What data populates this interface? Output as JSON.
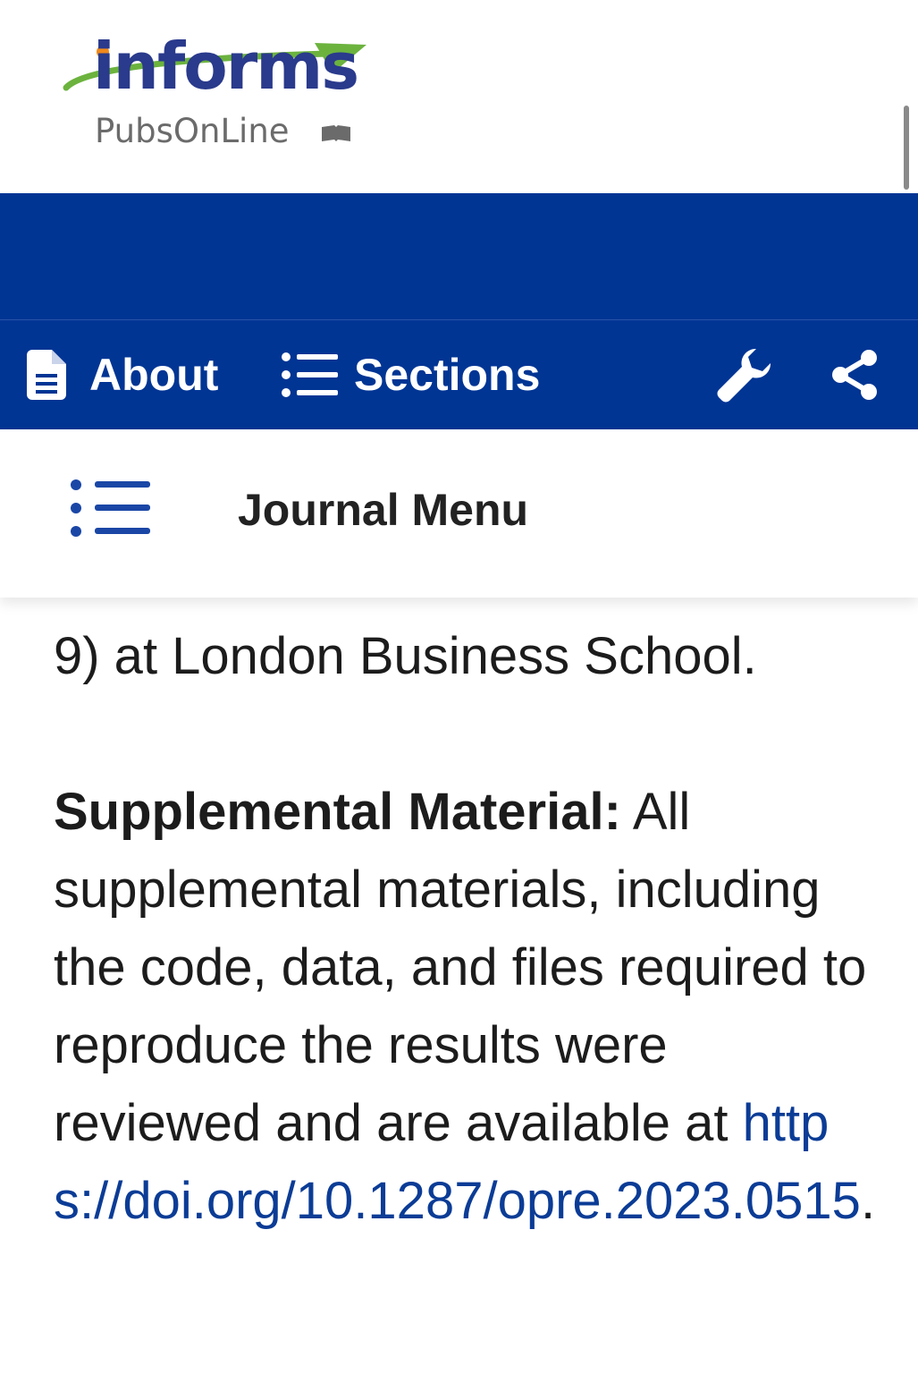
{
  "logo": {
    "word": "informs",
    "sub": "PubsOnLine",
    "colors": {
      "word": "#2a3a8c",
      "swoosh": "#6cb33e",
      "dot": "#f08a1c",
      "sub": "#6b6b6b"
    }
  },
  "toolbar": {
    "background": "#003594",
    "about_label": "About",
    "about_icon": "document-icon",
    "sections_label": "Sections",
    "sections_icon": "list-icon",
    "tools_icon": "wrench-icon",
    "share_icon": "share-icon"
  },
  "journal_menu": {
    "label": "Journal Menu",
    "icon": "list-icon"
  },
  "article": {
    "prev_line_end": "9) at London Business School.",
    "supplemental_heading": "Supplemental Material:",
    "supplemental_text": " All supplemental materials, including the code, data, and files required to reproduce the results were reviewed and are available at ",
    "doi_link": "https://doi.org/10.1287/opre.2023.0515",
    "trailing": ".",
    "link_color": "#0b3c96"
  }
}
